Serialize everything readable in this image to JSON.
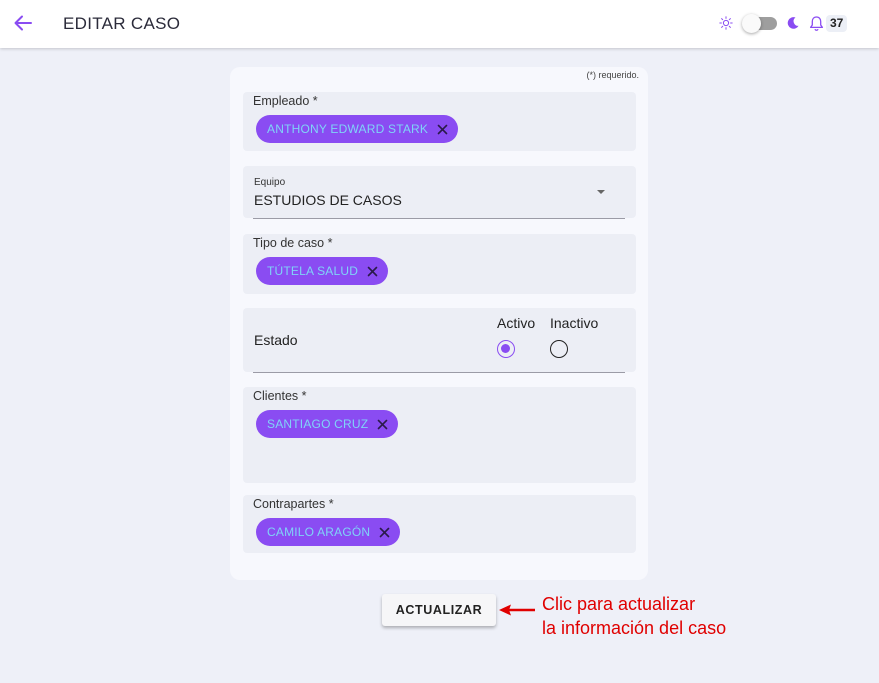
{
  "header": {
    "title": "EDITAR CASO",
    "notification_count": "37",
    "back_icon": "arrow-left-icon",
    "theme_light_icon": "sun-icon",
    "theme_dark_icon": "moon-icon",
    "notification_icon": "bell-icon",
    "dark_mode_enabled": false
  },
  "form": {
    "required_note": "(*) requerido.",
    "empleado": {
      "label": "Empleado *",
      "chips": [
        "ANTHONY EDWARD STARK"
      ]
    },
    "equipo": {
      "label": "Equipo",
      "value": "ESTUDIOS DE CASOS"
    },
    "tipo_caso": {
      "label": "Tipo de caso *",
      "chips": [
        "TÚTELA SALUD"
      ]
    },
    "estado": {
      "label": "Estado",
      "options": [
        "Activo",
        "Inactivo"
      ],
      "selected": "Activo"
    },
    "clientes": {
      "label": "Clientes *",
      "chips": [
        "SANTIAGO CRUZ"
      ]
    },
    "contrapartes": {
      "label": "Contrapartes *",
      "chips": [
        "CAMILO ARAGÓN"
      ]
    }
  },
  "actions": {
    "update_label": "ACTUALIZAR"
  },
  "annotation": {
    "line1": "Clic para actualizar",
    "line2": "la información del caso"
  },
  "colors": {
    "accent": "#8a4cf2",
    "chip_text": "#7fd4f7",
    "annotation": "#e00000",
    "background": "#eef0f8"
  }
}
